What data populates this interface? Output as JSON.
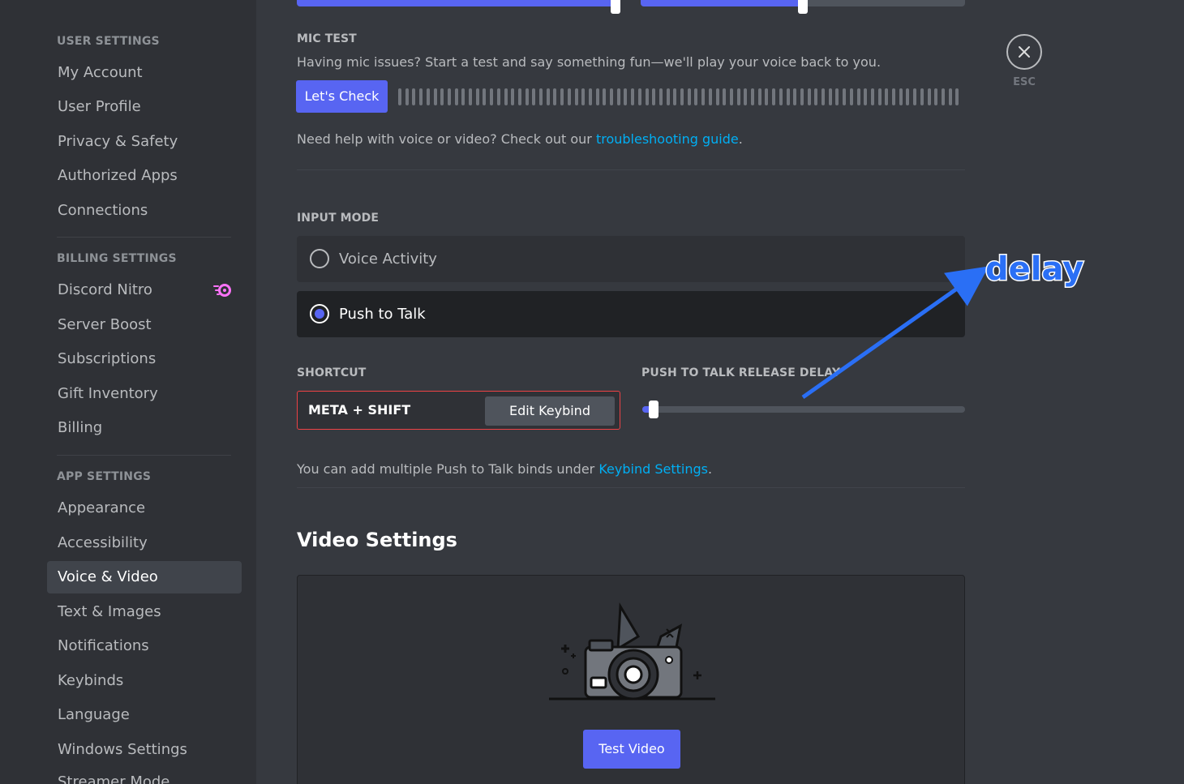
{
  "sidebar": {
    "sections": [
      {
        "title": "USER SETTINGS",
        "items": [
          "My Account",
          "User Profile",
          "Privacy & Safety",
          "Authorized Apps",
          "Connections"
        ]
      },
      {
        "title": "BILLING SETTINGS",
        "items": [
          "Discord Nitro",
          "Server Boost",
          "Subscriptions",
          "Gift Inventory",
          "Billing"
        ]
      },
      {
        "title": "APP SETTINGS",
        "items": [
          "Appearance",
          "Accessibility",
          "Voice & Video",
          "Text & Images",
          "Notifications",
          "Keybinds",
          "Language",
          "Windows Settings",
          "Streamer Mode"
        ]
      }
    ],
    "active_item": "Voice & Video"
  },
  "mic_test": {
    "title": "MIC TEST",
    "description": "Having mic issues? Start a test and say something fun—we'll play your voice back to you.",
    "button": "Let's Check"
  },
  "help": {
    "prefix": "Need help with voice or video? Check out our ",
    "link": "troubleshooting guide",
    "suffix": "."
  },
  "input_mode": {
    "title": "INPUT MODE",
    "options": [
      {
        "label": "Voice Activity",
        "selected": false
      },
      {
        "label": "Push to Talk",
        "selected": true
      }
    ]
  },
  "shortcut": {
    "title": "SHORTCUT",
    "value": "META + SHIFT",
    "edit_button": "Edit Keybind"
  },
  "release_delay": {
    "title": "PUSH TO TALK RELEASE DELAY",
    "value_fraction": 0.02
  },
  "keybind_note": {
    "prefix": "You can add multiple Push to Talk binds under ",
    "link": "Keybind Settings",
    "suffix": "."
  },
  "video": {
    "title": "Video Settings",
    "test_button": "Test Video"
  },
  "esc": {
    "label": "ESC"
  },
  "annotation": {
    "text": "delay",
    "color": "#2a6ff5"
  },
  "colors": {
    "accent": "#5865f2",
    "link": "#00aff4",
    "error": "#ed4245"
  },
  "icons": {
    "close": "close-icon",
    "nitro": "nitro-icon",
    "camera": "camera-illustration"
  }
}
